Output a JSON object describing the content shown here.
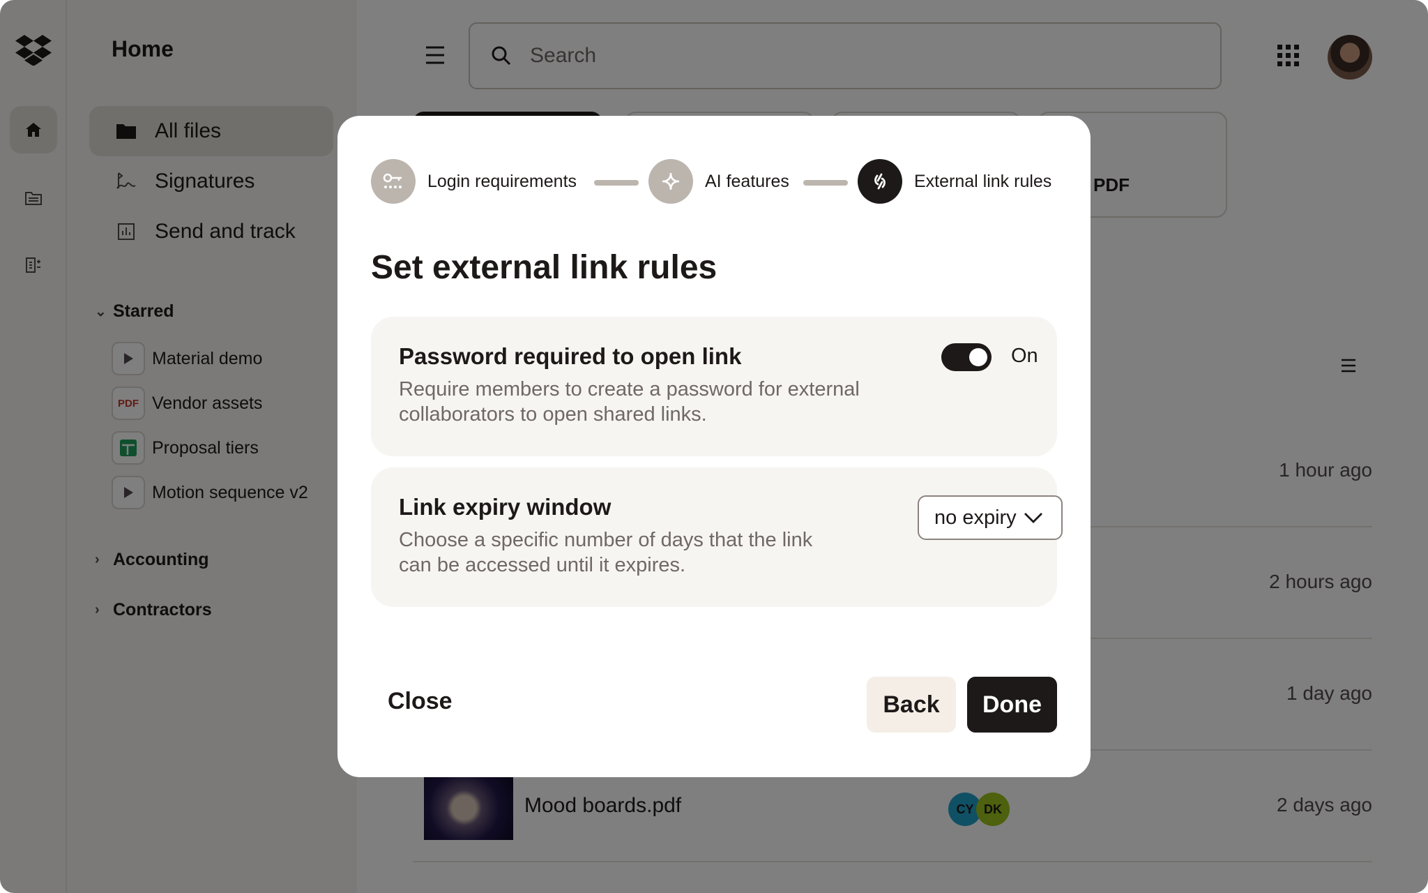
{
  "app": {
    "sidebar_title": "Home",
    "search_placeholder": "Search"
  },
  "sidebar": {
    "nav": [
      {
        "label": "All files",
        "icon": "folder-icon",
        "active": true
      },
      {
        "label": "Signatures",
        "icon": "signature-icon"
      },
      {
        "label": "Send and track",
        "icon": "chart-icon"
      }
    ],
    "starred_label": "Starred",
    "starred_items": [
      {
        "label": "Material demo",
        "icon": "play-icon"
      },
      {
        "label": "Vendor assets",
        "icon": "pdf-icon",
        "badge": "PDF"
      },
      {
        "label": "Proposal tiers",
        "icon": "sheet-icon"
      },
      {
        "label": "Motion sequence v2",
        "icon": "play-icon"
      }
    ],
    "sections": [
      "Accounting",
      "Contractors"
    ]
  },
  "main": {
    "chip_partial_text": "PDF",
    "rows": [
      {
        "time": "1 hour ago"
      },
      {
        "time": "2 hours ago"
      },
      {
        "time": "1 day ago"
      },
      {
        "name": "Mood boards.pdf",
        "time": "2 days ago",
        "collaborators": [
          "CY",
          "DK"
        ]
      }
    ]
  },
  "modal": {
    "steps": [
      {
        "label": "Login requirements",
        "icon": "key-icon"
      },
      {
        "label": "AI features",
        "icon": "ai-sparkle-icon"
      },
      {
        "label": "External link rules",
        "icon": "link-icon",
        "current": true
      }
    ],
    "title": "Set external link rules",
    "password_card": {
      "title": "Password required to open link",
      "description": "Require members to create a password for external collaborators to open shared links.",
      "toggle_label": "On",
      "toggle_on": true
    },
    "expiry_card": {
      "title": "Link expiry window",
      "description": "Choose a specific number of days that the link can be accessed until it expires.",
      "selected": "no expiry"
    },
    "close_label": "Close",
    "back_label": "Back",
    "done_label": "Done"
  },
  "colors": {
    "ink": "#1e1919",
    "surface": "#f7f5f2",
    "stepper_inactive": "#bbb5ae",
    "bubble_cy": "#20a0c8",
    "bubble_dk": "#9bc21c"
  }
}
